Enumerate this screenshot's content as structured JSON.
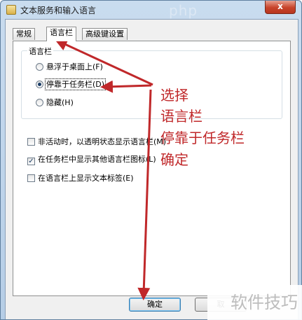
{
  "window": {
    "title": "文本服务和输入语言",
    "close_symbol": "x"
  },
  "tabs": [
    {
      "label": "常规",
      "active": false
    },
    {
      "label": "语言栏",
      "active": true
    },
    {
      "label": "高级键设置",
      "active": false
    }
  ],
  "language_bar_group": {
    "label": "语言栏",
    "options": [
      {
        "label": "悬浮于桌面上(F)",
        "checked": false
      },
      {
        "label": "停靠于任务栏(D)",
        "checked": true
      },
      {
        "label": "隐藏(H)",
        "checked": false
      }
    ]
  },
  "checkboxes": [
    {
      "label": "非活动时，以透明状态显示语言栏(M)",
      "checked": false
    },
    {
      "label": "在任务栏中显示其他语言栏图标(L)",
      "checked": true
    },
    {
      "label": "在语言栏上显示文本标签(E)",
      "checked": false
    }
  ],
  "buttons": {
    "ok": "确定",
    "cancel": "取"
  },
  "annotation": {
    "lines": [
      "选择",
      "语言栏",
      "停靠于任务栏",
      "确定"
    ],
    "color": "#c0282a"
  },
  "watermarks": {
    "top": "php",
    "bottom": "软件技巧"
  }
}
